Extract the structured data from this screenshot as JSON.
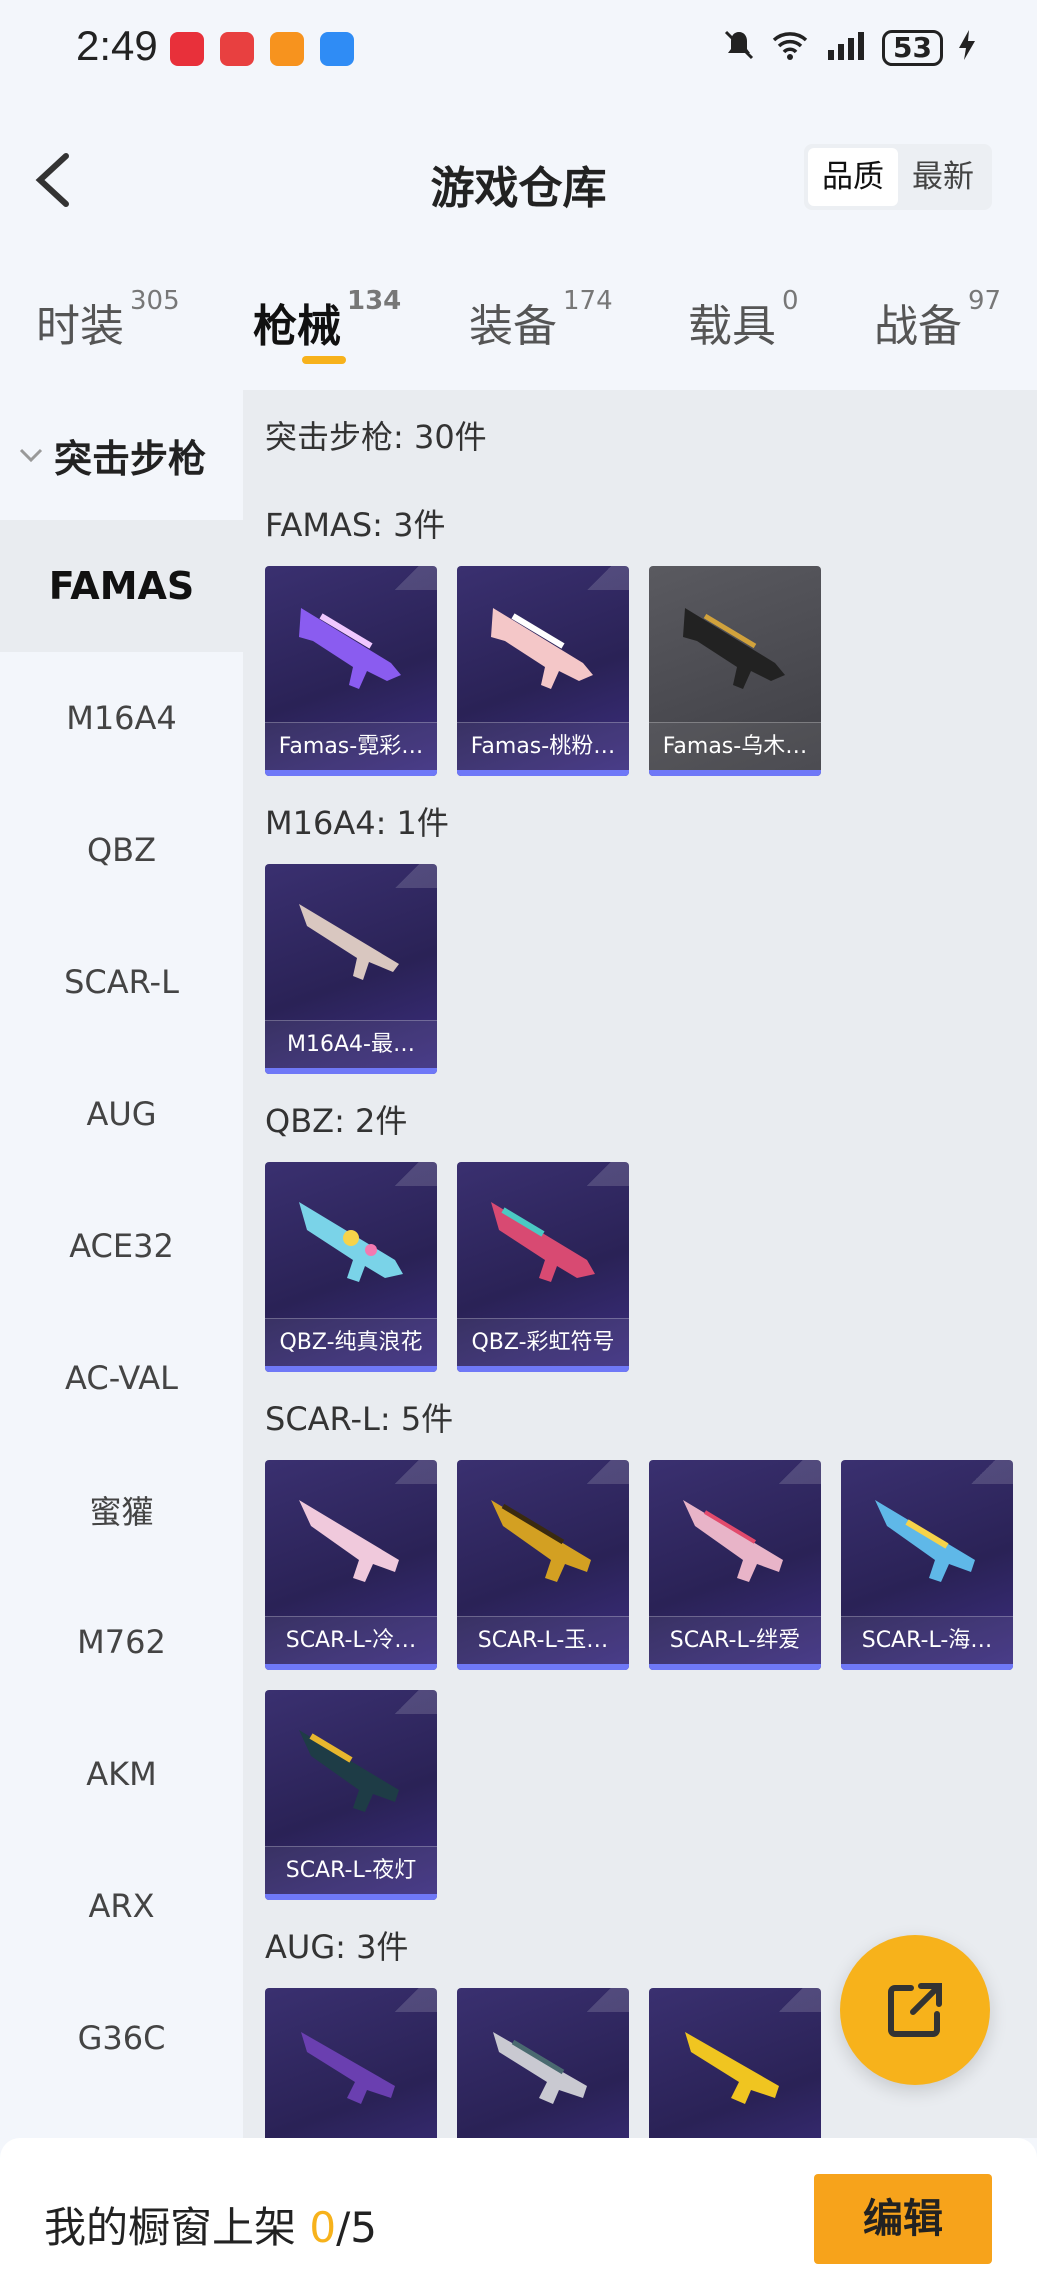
{
  "status_bar": {
    "time": "2:49",
    "signal": "4G",
    "wifi_label": "6",
    "battery": "53"
  },
  "header": {
    "title": "游戏仓库",
    "sort_options": [
      "品质",
      "最新"
    ]
  },
  "tabs": [
    {
      "label": "时装",
      "count": "305"
    },
    {
      "label": "枪械",
      "count": "134"
    },
    {
      "label": "装备",
      "count": "174"
    },
    {
      "label": "载具",
      "count": "0"
    },
    {
      "label": "战备",
      "count": "97"
    }
  ],
  "sidebar": {
    "group": "突击步枪",
    "items": [
      "FAMAS",
      "M16A4",
      "QBZ",
      "SCAR-L",
      "AUG",
      "ACE32",
      "AC-VAL",
      "蜜獾",
      "M762",
      "AKM",
      "ARX",
      "G36C"
    ]
  },
  "content": {
    "summary": "突击步枪: 30件",
    "sections": [
      {
        "title": "FAMAS: 3件",
        "items": [
          "Famas-霓彩…",
          "Famas-桃粉…",
          "Famas-乌木…"
        ]
      },
      {
        "title": "M16A4: 1件",
        "items": [
          "M16A4-最…"
        ]
      },
      {
        "title": "QBZ: 2件",
        "items": [
          "QBZ-纯真浪花",
          "QBZ-彩虹符号"
        ]
      },
      {
        "title": "SCAR-L: 5件",
        "items": [
          "SCAR-L-冷…",
          "SCAR-L-玉…",
          "SCAR-L-绊爱",
          "SCAR-L-海…",
          "SCAR-L-夜灯"
        ]
      },
      {
        "title": "AUG: 3件",
        "items": [
          "",
          "",
          ""
        ]
      }
    ]
  },
  "bottom": {
    "label": "我的橱窗上架",
    "used": "0",
    "total": "/5",
    "edit": "编辑"
  },
  "colors": {
    "accent": "#f7b21b",
    "card_bg": "#2a2256",
    "card_bar": "#6f78f7"
  }
}
